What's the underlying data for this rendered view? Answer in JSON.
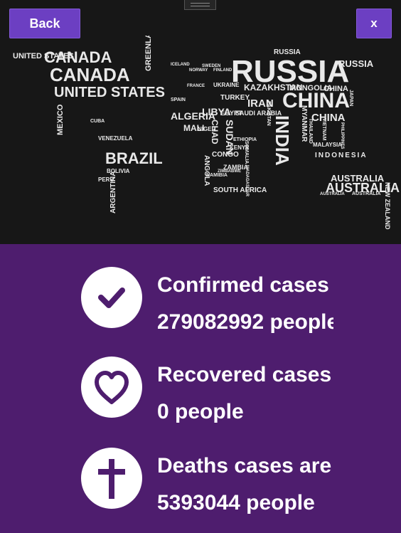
{
  "header": {
    "back_label": "Back",
    "close_label": "x"
  },
  "map_words": [
    "UNITED STATES",
    "CANADA",
    "UNITED STATES",
    "MEXICO",
    "CUBA",
    "VENEZUELA",
    "BRAZIL",
    "BOLIVIA",
    "ARGENTINA",
    "PERU",
    "GREENLAND",
    "ICELAND",
    "RUSSIA",
    "KAZAKHSTAN",
    "MONGOLIA",
    "CHINA",
    "INDIA",
    "IRAN",
    "TURKEY",
    "UKRAINE",
    "LIBYA",
    "EGYPT",
    "SUDAN",
    "CHAD",
    "NIGER",
    "ALGERIA",
    "MALI",
    "CONGO",
    "ANGOLA",
    "NAMIBIA",
    "SOUTH AFRICA",
    "ZAMBIA",
    "KENYA",
    "SOMALIA",
    "ETHIOPIA",
    "SAUDI ARABIA",
    "PAKISTAN",
    "MYANMAR",
    "THAILAND",
    "VIETNAM",
    "MALAYSIA",
    "INDONESIA",
    "JAPAN",
    "PHILIPPINES",
    "AUSTRALIA",
    "NEW ZEALAND",
    "MADAGASCAR",
    "ZIMBABWE",
    "FRANCE",
    "SPAIN",
    "SWEDEN",
    "NORWAY",
    "FINLAND"
  ],
  "stats": [
    {
      "icon": "check-icon",
      "title": "Confirmed cases",
      "value": "279082992 people"
    },
    {
      "icon": "heart-icon",
      "title": "Recovered cases",
      "value": "0 people"
    },
    {
      "icon": "cross-icon",
      "title": "Deaths cases are",
      "value": "5393044 people"
    }
  ]
}
